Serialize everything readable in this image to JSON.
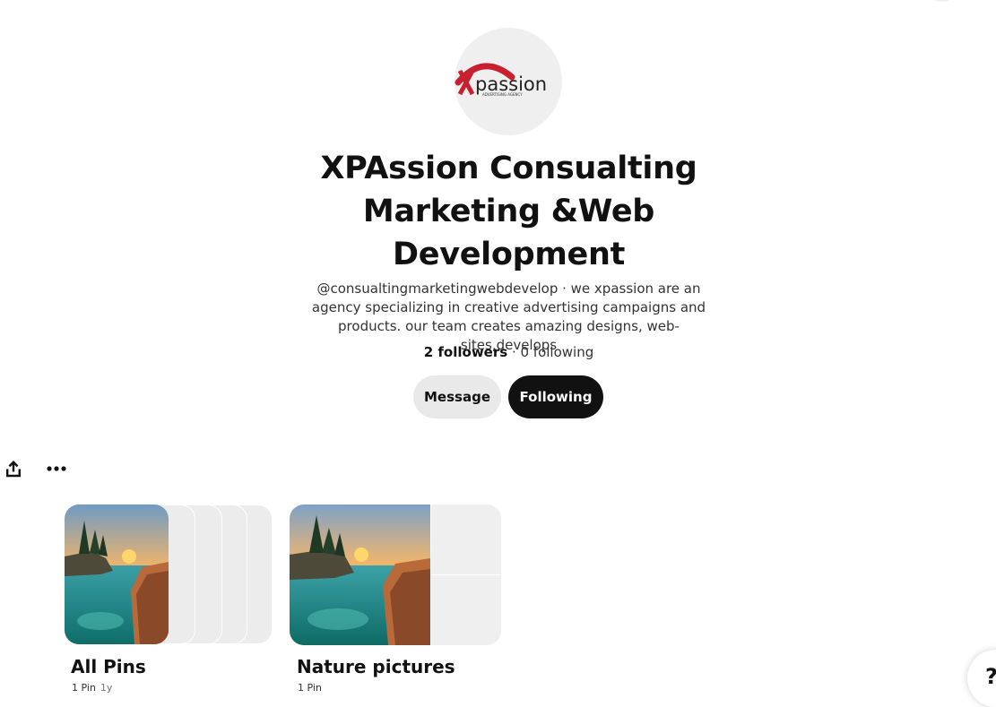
{
  "profile": {
    "logo_text": "passion",
    "logo_tagline": "ADVERTISING AGENCY",
    "name": "XPAssion Consualting Marketing &Web Development",
    "bio": "@consualtingmarketingwebdevelop · we xpassion are an agency specializing in creative advertising campaigns and products. our team creates amazing designs, web-sites,develops",
    "followers": "2 followers",
    "following": " · 0 following"
  },
  "actions": {
    "message_label": "Message",
    "following_label": "Following"
  },
  "toolbar": {
    "share_icon": "share-icon",
    "more_icon": "more-icon"
  },
  "boards": [
    {
      "title": "All Pins",
      "pins": "1 Pin",
      "age": "1y"
    },
    {
      "title": "Nature pictures",
      "pins": "1 Pin"
    }
  ],
  "help": {
    "label": "?"
  },
  "colors": {
    "accent": "#111111",
    "button_secondary": "#e9e9e9",
    "placeholder": "#efefef",
    "logo_red": "#c8202f"
  }
}
